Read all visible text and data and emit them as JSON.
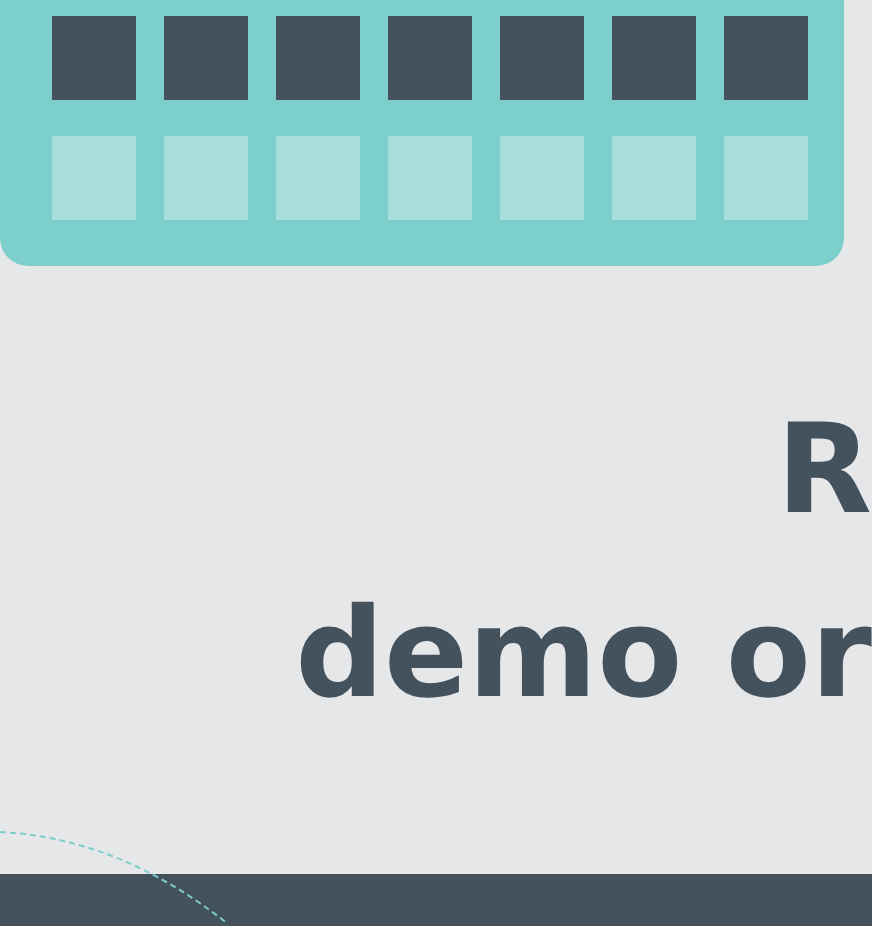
{
  "heading": {
    "lines": [
      "R",
      "demo or"
    ]
  }
}
